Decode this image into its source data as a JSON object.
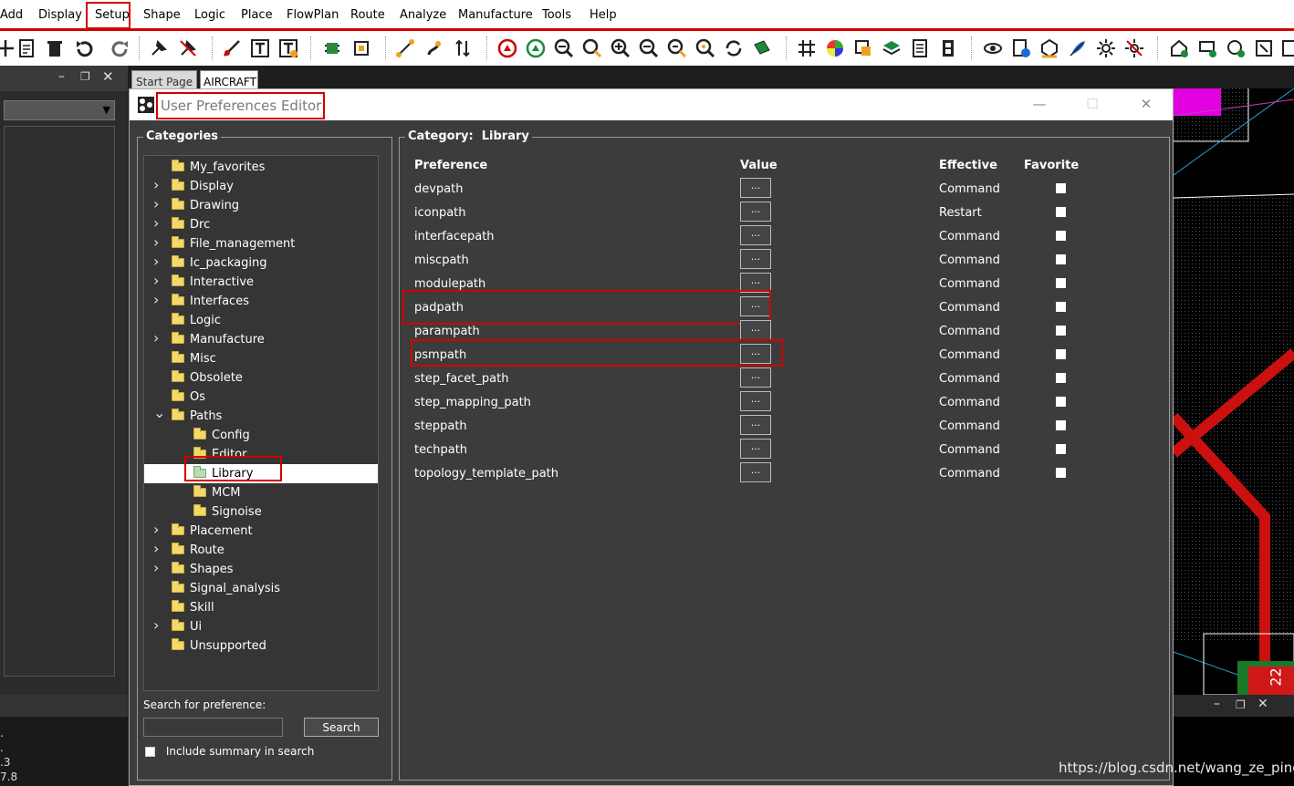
{
  "menu": {
    "items": [
      {
        "label": "Add"
      },
      {
        "label": "Display"
      },
      {
        "label": "Setup"
      },
      {
        "label": "Shape"
      },
      {
        "label": "Logic"
      },
      {
        "label": "Place"
      },
      {
        "label": "FlowPlan"
      },
      {
        "label": "Route"
      },
      {
        "label": "Analyze"
      },
      {
        "label": "Manufacture"
      },
      {
        "label": "Tools"
      },
      {
        "label": "Help"
      }
    ]
  },
  "tabs": {
    "start_page": "Start Page",
    "aircraft": "AIRCRAFT"
  },
  "dialog": {
    "title": "User Preferences Editor",
    "categories_label": "Categories",
    "category_label": "Category:",
    "category_value": "Library",
    "search_label": "Search for preference:",
    "search_value": "",
    "search_button": "Search",
    "include_summary": "Include summary in search"
  },
  "tree": [
    {
      "label": "My_favorites",
      "expandable": false,
      "level": 0
    },
    {
      "label": "Display",
      "expandable": true,
      "level": 0
    },
    {
      "label": "Drawing",
      "expandable": true,
      "level": 0
    },
    {
      "label": "Drc",
      "expandable": true,
      "level": 0
    },
    {
      "label": "File_management",
      "expandable": true,
      "level": 0
    },
    {
      "label": "Ic_packaging",
      "expandable": true,
      "level": 0
    },
    {
      "label": "Interactive",
      "expandable": true,
      "level": 0
    },
    {
      "label": "Interfaces",
      "expandable": true,
      "level": 0
    },
    {
      "label": "Logic",
      "expandable": false,
      "level": 0
    },
    {
      "label": "Manufacture",
      "expandable": true,
      "level": 0
    },
    {
      "label": "Misc",
      "expandable": false,
      "level": 0
    },
    {
      "label": "Obsolete",
      "expandable": false,
      "level": 0
    },
    {
      "label": "Os",
      "expandable": false,
      "level": 0
    },
    {
      "label": "Paths",
      "expandable": true,
      "expanded": true,
      "level": 0
    },
    {
      "label": "Config",
      "expandable": false,
      "level": 1
    },
    {
      "label": "Editor",
      "expandable": false,
      "level": 1
    },
    {
      "label": "Library",
      "expandable": false,
      "level": 1,
      "selected": true
    },
    {
      "label": "MCM",
      "expandable": false,
      "level": 1
    },
    {
      "label": "Signoise",
      "expandable": false,
      "level": 1
    },
    {
      "label": "Placement",
      "expandable": true,
      "level": 0
    },
    {
      "label": "Route",
      "expandable": true,
      "level": 0
    },
    {
      "label": "Shapes",
      "expandable": true,
      "level": 0
    },
    {
      "label": "Signal_analysis",
      "expandable": false,
      "level": 0
    },
    {
      "label": "Skill",
      "expandable": false,
      "level": 0
    },
    {
      "label": "Ui",
      "expandable": true,
      "level": 0
    },
    {
      "label": "Unsupported",
      "expandable": false,
      "level": 0
    }
  ],
  "table": {
    "headers": {
      "preference": "Preference",
      "value": "Value",
      "effective": "Effective",
      "favorite": "Favorite"
    },
    "value_button": "...",
    "rows": [
      {
        "name": "devpath",
        "effective": "Command"
      },
      {
        "name": "iconpath",
        "effective": "Restart"
      },
      {
        "name": "interfacepath",
        "effective": "Command"
      },
      {
        "name": "miscpath",
        "effective": "Command"
      },
      {
        "name": "modulepath",
        "effective": "Command"
      },
      {
        "name": "padpath",
        "effective": "Command",
        "highlight": true
      },
      {
        "name": "parampath",
        "effective": "Command"
      },
      {
        "name": "psmpath",
        "effective": "Command",
        "highlight": true
      },
      {
        "name": "step_facet_path",
        "effective": "Command"
      },
      {
        "name": "step_mapping_path",
        "effective": "Command"
      },
      {
        "name": "steppath",
        "effective": "Command"
      },
      {
        "name": "techpath",
        "effective": "Command"
      },
      {
        "name": "topology_template_path",
        "effective": "Command"
      }
    ]
  },
  "left_bottom_lines": [
    ".",
    ".",
    ".3",
    "7.8"
  ],
  "canvas_label": "22",
  "watermark": "https://blog.csdn.net/wang_ze_ping",
  "colors": {
    "highlight": "#d40000",
    "dialog_bg": "#3c3c3c",
    "selected_folder": "#b7ddb0",
    "folder": "#f3d86a"
  }
}
